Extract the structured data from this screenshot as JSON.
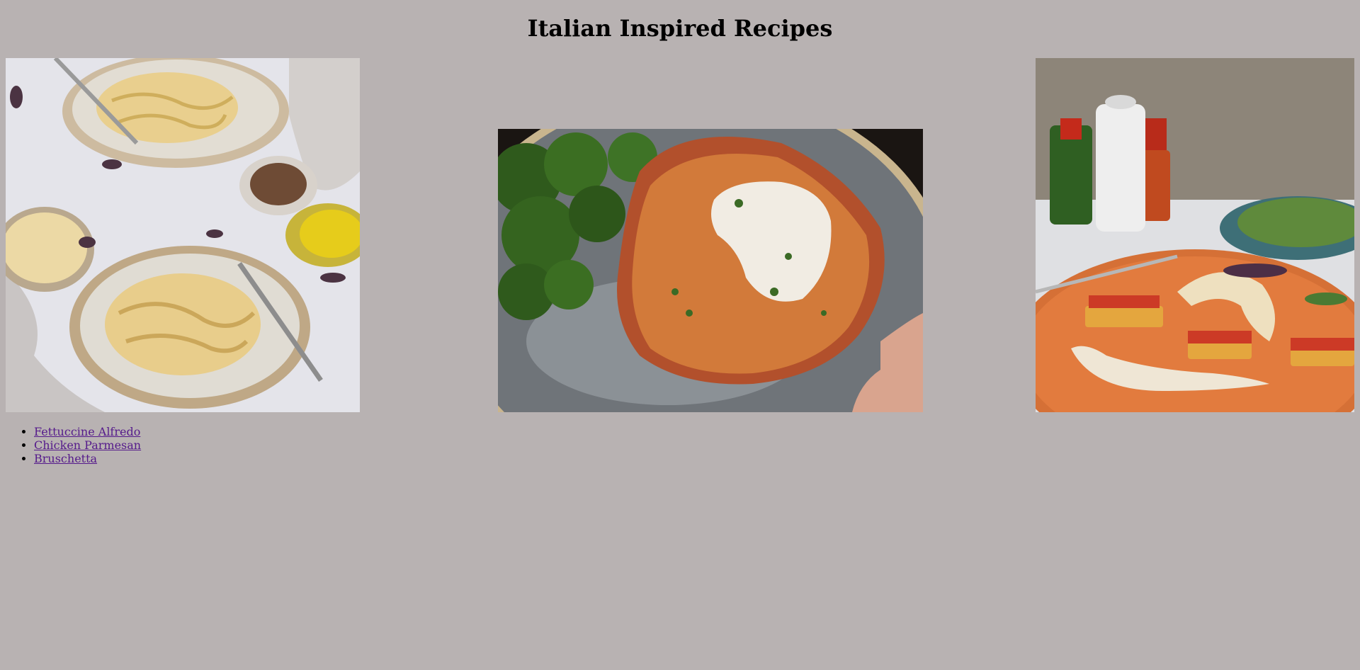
{
  "page": {
    "title": "Italian Inspired Recipes",
    "background_color": "#b8b2b2",
    "link_color": "#551a8b"
  },
  "images": [
    {
      "name": "fettuccine-alfredo-photo"
    },
    {
      "name": "chicken-parmesan-photo"
    },
    {
      "name": "bruschetta-photo"
    }
  ],
  "recipes": [
    {
      "label": "Fettuccine Alfredo"
    },
    {
      "label": "Chicken Parmesan"
    },
    {
      "label": "Bruschetta"
    }
  ]
}
